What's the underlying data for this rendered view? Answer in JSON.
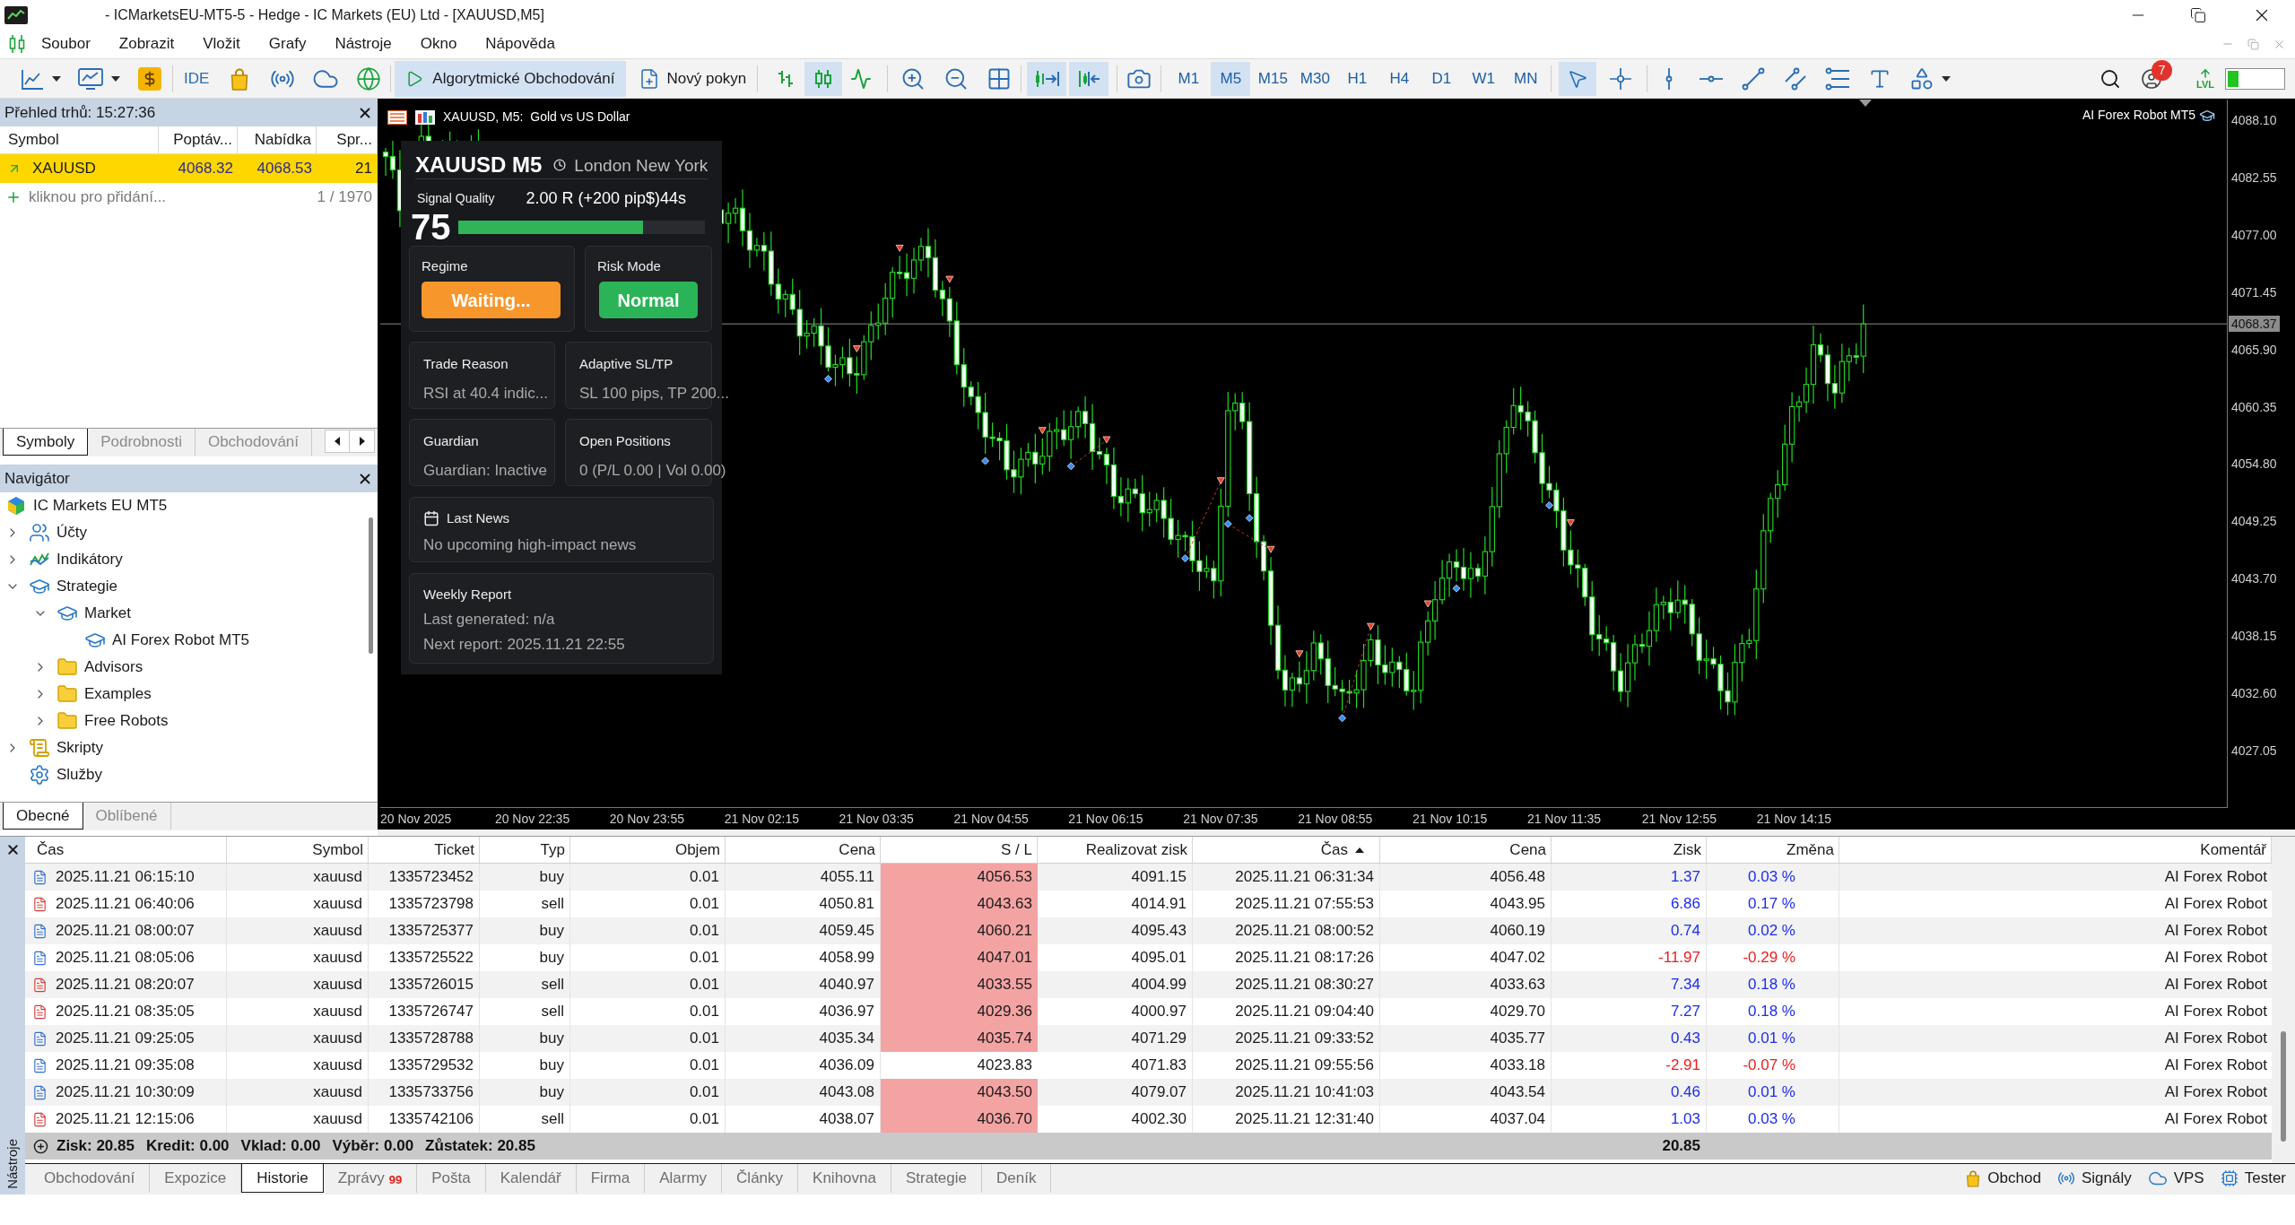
{
  "window": {
    "title": "- ICMarketsEU-MT5-5 - Hedge - IC Markets (EU) Ltd - [XAUUSD,M5]"
  },
  "menu": [
    "Soubor",
    "Zobrazit",
    "Vložit",
    "Grafy",
    "Nástroje",
    "Okno",
    "Nápověda"
  ],
  "toolbar": {
    "ide": "IDE",
    "algo_trading": {
      "label": "Algorytmické Obchodování",
      "selected": true
    },
    "new_order": "Nový pokyn",
    "chart_types": [
      {
        "kind": "bars",
        "selected": false
      },
      {
        "kind": "candles",
        "selected": true
      },
      {
        "kind": "line",
        "selected": false
      }
    ],
    "view_toggles": [
      {
        "kind": "autoscroll",
        "selected": true
      },
      {
        "kind": "chart_shift",
        "selected": true
      }
    ],
    "timeframes": [
      {
        "label": "M1",
        "selected": false
      },
      {
        "label": "M5",
        "selected": true
      },
      {
        "label": "M15",
        "selected": false
      },
      {
        "label": "M30",
        "selected": false
      },
      {
        "label": "H1",
        "selected": false
      },
      {
        "label": "H4",
        "selected": false
      },
      {
        "label": "D1",
        "selected": false
      },
      {
        "label": "W1",
        "selected": false
      },
      {
        "label": "MN",
        "selected": false
      }
    ],
    "pointer_tools": [
      {
        "kind": "cursor",
        "selected": true
      },
      {
        "kind": "crosshair",
        "selected": false
      }
    ],
    "notification_count": "7",
    "level_label": "LVL",
    "level_meter": {
      "level": 0.2
    }
  },
  "market_watch": {
    "title": "Přehled trhů: 15:27:36",
    "columns": [
      "Symbol",
      "Poptáv...",
      "Nabídka",
      "Spr..."
    ],
    "rows": [
      {
        "symbol": "XAUUSD",
        "bid": "4068.32",
        "ask": "4068.53",
        "spread": "21",
        "selected": true
      }
    ],
    "add_row": {
      "label": "kliknou pro přidání...",
      "count": "1 / 1970"
    },
    "tabs": [
      {
        "label": "Symboly",
        "selected": true
      },
      {
        "label": "Podrobnosti",
        "selected": false
      },
      {
        "label": "Obchodování",
        "selected": false
      }
    ]
  },
  "navigator": {
    "title": "Navigátor",
    "tree": [
      {
        "label": "IC Markets EU MT5",
        "kind": "broker",
        "children": [
          {
            "label": "Účty",
            "kind": "accounts",
            "expanded": false
          },
          {
            "label": "Indikátory",
            "kind": "indicators",
            "expanded": false
          },
          {
            "label": "Strategie",
            "kind": "strategy",
            "expanded": true,
            "children": [
              {
                "label": "Market",
                "kind": "strategy",
                "expanded": true,
                "children": [
                  {
                    "label": "AI Forex Robot MT5",
                    "kind": "strategy"
                  }
                ]
              },
              {
                "label": "Advisors",
                "kind": "folder",
                "expanded": false
              },
              {
                "label": "Examples",
                "kind": "folder",
                "expanded": false
              },
              {
                "label": "Free Robots",
                "kind": "folder",
                "expanded": false
              }
            ]
          },
          {
            "label": "Skripty",
            "kind": "script",
            "expanded": false
          },
          {
            "label": "Služby",
            "kind": "service"
          }
        ]
      }
    ],
    "tabs": [
      {
        "label": "Obecné",
        "selected": true
      },
      {
        "label": "Oblíbené",
        "selected": false
      }
    ]
  },
  "chart": {
    "title": "XAUUSD, M5:  Gold vs US Dollar",
    "expert": "AI Forex Robot MT5",
    "price_labels": [
      "4088.10",
      "4082.55",
      "4077.00",
      "4071.45",
      "4065.90",
      "4060.35",
      "4054.80",
      "4049.25",
      "4043.70",
      "4038.15",
      "4032.60",
      "4027.05"
    ],
    "current_price": "4068.37",
    "time_labels": [
      "20 Nov 2025",
      "20 Nov 22:35",
      "20 Nov 23:55",
      "21 Nov 02:15",
      "21 Nov 03:35",
      "21 Nov 04:55",
      "21 Nov 06:15",
      "21 Nov 07:35",
      "21 Nov 08:55",
      "21 Nov 10:15",
      "21 Nov 11:35",
      "21 Nov 12:55",
      "21 Nov 14:15"
    ]
  },
  "dashboard": {
    "symbol": "XAUUSD M5",
    "sessions": "London New York",
    "signal_label": "Signal Quality",
    "target": "2.00 R (+200 pip$)44s",
    "score": "75",
    "quality": {
      "level": 0.75
    },
    "badges": [
      {
        "label": "Regime",
        "value": "Waiting...",
        "color": "#f7962a"
      },
      {
        "label": "Risk Mode",
        "value": "Normal",
        "color": "#2bb357"
      }
    ],
    "cards": [
      {
        "label": "Trade Reason",
        "value": "RSI at 40.4 indic..."
      },
      {
        "label": "Adaptive SL/TP",
        "value": "SL 100 pips, TP 200..."
      },
      {
        "label": "Guardian",
        "value": "Guardian: Inactive"
      },
      {
        "label": "Open Positions",
        "value": "0 (P/L 0.00 | Vol 0.00)"
      }
    ],
    "news": {
      "label": "Last News",
      "value": "No upcoming high-impact news"
    },
    "weekly_report": {
      "label": "Weekly Report",
      "lines": [
        "Last generated: n/a",
        "Next report: 2025.11.21 22:55"
      ]
    }
  },
  "history": {
    "columns": [
      {
        "label": "Čas",
        "sorted": false
      },
      {
        "label": "Symbol",
        "sorted": false
      },
      {
        "label": "Ticket",
        "sorted": false
      },
      {
        "label": "Typ",
        "sorted": false
      },
      {
        "label": "Objem",
        "sorted": false
      },
      {
        "label": "Cena",
        "sorted": false
      },
      {
        "label": "S / L",
        "sorted": false
      },
      {
        "label": "Realizovat zisk",
        "sorted": false
      },
      {
        "label": "Čas",
        "sorted": true
      },
      {
        "label": "Cena",
        "sorted": false
      },
      {
        "label": "Zisk",
        "sorted": false
      },
      {
        "label": "Změna",
        "sorted": false
      },
      {
        "label": "Komentář",
        "sorted": false
      }
    ],
    "rows": [
      {
        "kind": "buy",
        "open_time": "2025.11.21 06:15:10",
        "symbol": "xauusd",
        "ticket": "1335723452",
        "type": "buy",
        "volume": "0.01",
        "open_price": "4055.11",
        "sl": "4056.53",
        "sl_hit": true,
        "tp": "4091.15",
        "close_time": "2025.11.21 06:31:34",
        "close_price": "4056.48",
        "profit": "1.37",
        "change": "0.03 %",
        "negative": false,
        "comment": "AI Forex Robot"
      },
      {
        "kind": "sell",
        "open_time": "2025.11.21 06:40:06",
        "symbol": "xauusd",
        "ticket": "1335723798",
        "type": "sell",
        "volume": "0.01",
        "open_price": "4050.81",
        "sl": "4043.63",
        "sl_hit": true,
        "tp": "4014.91",
        "close_time": "2025.11.21 07:55:53",
        "close_price": "4043.95",
        "profit": "6.86",
        "change": "0.17 %",
        "negative": false,
        "comment": "AI Forex Robot"
      },
      {
        "kind": "buy",
        "open_time": "2025.11.21 08:00:07",
        "symbol": "xauusd",
        "ticket": "1335725377",
        "type": "buy",
        "volume": "0.01",
        "open_price": "4059.45",
        "sl": "4060.21",
        "sl_hit": true,
        "tp": "4095.43",
        "close_time": "2025.11.21 08:00:52",
        "close_price": "4060.19",
        "profit": "0.74",
        "change": "0.02 %",
        "negative": false,
        "comment": "AI Forex Robot"
      },
      {
        "kind": "buy",
        "open_time": "2025.11.21 08:05:06",
        "symbol": "xauusd",
        "ticket": "1335725522",
        "type": "buy",
        "volume": "0.01",
        "open_price": "4058.99",
        "sl": "4047.01",
        "sl_hit": true,
        "tp": "4095.01",
        "close_time": "2025.11.21 08:17:26",
        "close_price": "4047.02",
        "profit": "-11.97",
        "change": "-0.29 %",
        "negative": true,
        "comment": "AI Forex Robot"
      },
      {
        "kind": "sell",
        "open_time": "2025.11.21 08:20:07",
        "symbol": "xauusd",
        "ticket": "1335726015",
        "type": "sell",
        "volume": "0.01",
        "open_price": "4040.97",
        "sl": "4033.55",
        "sl_hit": true,
        "tp": "4004.99",
        "close_time": "2025.11.21 08:30:27",
        "close_price": "4033.63",
        "profit": "7.34",
        "change": "0.18 %",
        "negative": false,
        "comment": "AI Forex Robot"
      },
      {
        "kind": "sell",
        "open_time": "2025.11.21 08:35:05",
        "symbol": "xauusd",
        "ticket": "1335726747",
        "type": "sell",
        "volume": "0.01",
        "open_price": "4036.97",
        "sl": "4029.36",
        "sl_hit": true,
        "tp": "4000.97",
        "close_time": "2025.11.21 09:04:40",
        "close_price": "4029.70",
        "profit": "7.27",
        "change": "0.18 %",
        "negative": false,
        "comment": "AI Forex Robot"
      },
      {
        "kind": "buy",
        "open_time": "2025.11.21 09:25:05",
        "symbol": "xauusd",
        "ticket": "1335728788",
        "type": "buy",
        "volume": "0.01",
        "open_price": "4035.34",
        "sl": "4035.74",
        "sl_hit": true,
        "tp": "4071.29",
        "close_time": "2025.11.21 09:33:52",
        "close_price": "4035.77",
        "profit": "0.43",
        "change": "0.01 %",
        "negative": false,
        "comment": "AI Forex Robot"
      },
      {
        "kind": "buy",
        "open_time": "2025.11.21 09:35:08",
        "symbol": "xauusd",
        "ticket": "1335729532",
        "type": "buy",
        "volume": "0.01",
        "open_price": "4036.09",
        "sl": "4023.83",
        "sl_hit": false,
        "tp": "4071.83",
        "close_time": "2025.11.21 09:55:56",
        "close_price": "4033.18",
        "profit": "-2.91",
        "change": "-0.07 %",
        "negative": true,
        "comment": "AI Forex Robot"
      },
      {
        "kind": "buy",
        "open_time": "2025.11.21 10:30:09",
        "symbol": "xauusd",
        "ticket": "1335733756",
        "type": "buy",
        "volume": "0.01",
        "open_price": "4043.08",
        "sl": "4043.50",
        "sl_hit": true,
        "tp": "4079.07",
        "close_time": "2025.11.21 10:41:03",
        "close_price": "4043.54",
        "profit": "0.46",
        "change": "0.01 %",
        "negative": false,
        "comment": "AI Forex Robot"
      },
      {
        "kind": "sell",
        "open_time": "2025.11.21 12:15:06",
        "symbol": "xauusd",
        "ticket": "1335742106",
        "type": "sell",
        "volume": "0.01",
        "open_price": "4038.07",
        "sl": "4036.70",
        "sl_hit": true,
        "tp": "4002.30",
        "close_time": "2025.11.21 12:31:40",
        "close_price": "4037.04",
        "profit": "1.03",
        "change": "0.03 %",
        "negative": false,
        "comment": "AI Forex Robot"
      }
    ],
    "summary": {
      "items": [
        "Zisk: 20.85",
        "Kredit: 0.00",
        "Vklad: 0.00",
        "Výběr: 0.00",
        "Zůstatek: 20.85"
      ],
      "total": "20.85"
    }
  },
  "toolbox": {
    "label": "Nástroje",
    "tabs": [
      {
        "label": "Obchodování",
        "selected": false
      },
      {
        "label": "Expozice",
        "selected": false
      },
      {
        "label": "Historie",
        "selected": true
      },
      {
        "label": "Zprávy",
        "badge": "99",
        "selected": false
      },
      {
        "label": "Pošta",
        "selected": false
      },
      {
        "label": "Kalendář",
        "selected": false
      },
      {
        "label": "Firma",
        "selected": false
      },
      {
        "label": "Alarmy",
        "selected": false
      },
      {
        "label": "Články",
        "selected": false
      },
      {
        "label": "Knihovna",
        "selected": false
      },
      {
        "label": "Strategie",
        "selected": false
      },
      {
        "label": "Deník",
        "selected": false
      }
    ],
    "links": [
      {
        "label": "Obchod",
        "kind": "market"
      },
      {
        "label": "Signály",
        "kind": "signals"
      },
      {
        "label": "VPS",
        "kind": "vps"
      },
      {
        "label": "Tester",
        "kind": "tester"
      }
    ]
  }
}
